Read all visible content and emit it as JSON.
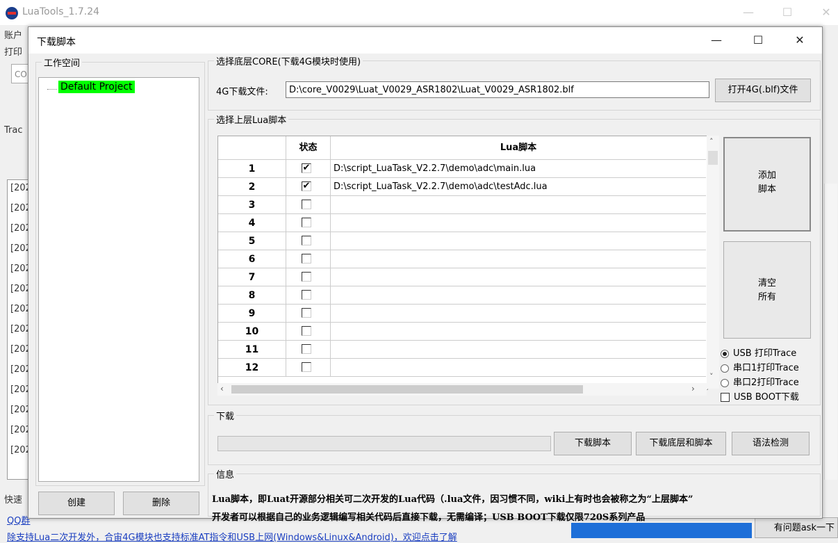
{
  "main_window": {
    "title": "LuaTools_1.7.24",
    "left_labels": [
      "账户",
      "打印",
      "Trac",
      "快速"
    ],
    "combo_text": "CO",
    "log_lines": [
      "[202",
      "[202",
      "[202",
      "[202",
      "[202",
      "[202",
      "[202",
      "[202",
      "[202",
      "[202",
      "[202",
      "[202",
      "[202",
      "[202"
    ],
    "bottom_link1": "QQ群",
    "bottom_link2": "除支持Lua二次开发外，合宙4G模块也支持标准AT指令和USB上网(Windows&Linux&Android)，欢迎点击了解",
    "bottom_button": "有问题ask一下",
    "controls": {
      "minimize": "—",
      "maximize": "☐",
      "close": "✕"
    }
  },
  "dialog": {
    "title": "下载脚本",
    "controls": {
      "minimize": "—",
      "maximize": "☐",
      "close": "✕"
    },
    "workspace": {
      "label": "工作空间",
      "tree_item": "Default Project",
      "create_button": "创建",
      "delete_button": "删除"
    },
    "core": {
      "label": "选择底层CORE(下载4G模块时使用)",
      "file_label": "4G下载文件:",
      "file_path": "D:\\core_V0029\\Luat_V0029_ASR1802\\Luat_V0029_ASR1802.blf",
      "open_button": "打开4G(.blf)文件"
    },
    "scripts": {
      "label": "选择上层Lua脚本",
      "col_status": "状态",
      "col_script": "Lua脚本",
      "rows": [
        {
          "no": "1",
          "checked": "✔",
          "path": "D:\\script_LuaTask_V2.2.7\\demo\\adc\\main.lua"
        },
        {
          "no": "2",
          "checked": "✔",
          "path": "D:\\script_LuaTask_V2.2.7\\demo\\adc\\testAdc.lua"
        },
        {
          "no": "3",
          "checked": "",
          "path": ""
        },
        {
          "no": "4",
          "checked": "",
          "path": ""
        },
        {
          "no": "5",
          "checked": "",
          "path": ""
        },
        {
          "no": "6",
          "checked": "",
          "path": ""
        },
        {
          "no": "7",
          "checked": "",
          "path": ""
        },
        {
          "no": "8",
          "checked": "",
          "path": ""
        },
        {
          "no": "9",
          "checked": "",
          "path": ""
        },
        {
          "no": "10",
          "checked": "",
          "path": ""
        },
        {
          "no": "11",
          "checked": "",
          "path": ""
        },
        {
          "no": "12",
          "checked": "",
          "path": ""
        }
      ],
      "add_button_l1": "添加",
      "add_button_l2": "脚本",
      "clear_button_l1": "清空",
      "clear_button_l2": "所有",
      "radio_usb": "USB 打印Trace",
      "radio_uart1": "串口1打印Trace",
      "radio_uart2": "串口2打印Trace",
      "check_usb_boot": "USB BOOT下载"
    },
    "download": {
      "label": "下载",
      "btn_script": "下载脚本",
      "btn_core_script": "下载底层和脚本",
      "btn_syntax": "语法检测",
      "progress": 0
    },
    "info": {
      "label": "信息",
      "line1": "Lua脚本，即Luat开源部分相关可二次开发的Lua代码（.lua文件，因习惯不同，wiki上有时也会被称之为“上层脚本”",
      "line2": "开发者可以根据自己的业务逻辑编写相关代码后直接下载，无需编译；USB BOOT下载仅限720S系列产品"
    }
  }
}
